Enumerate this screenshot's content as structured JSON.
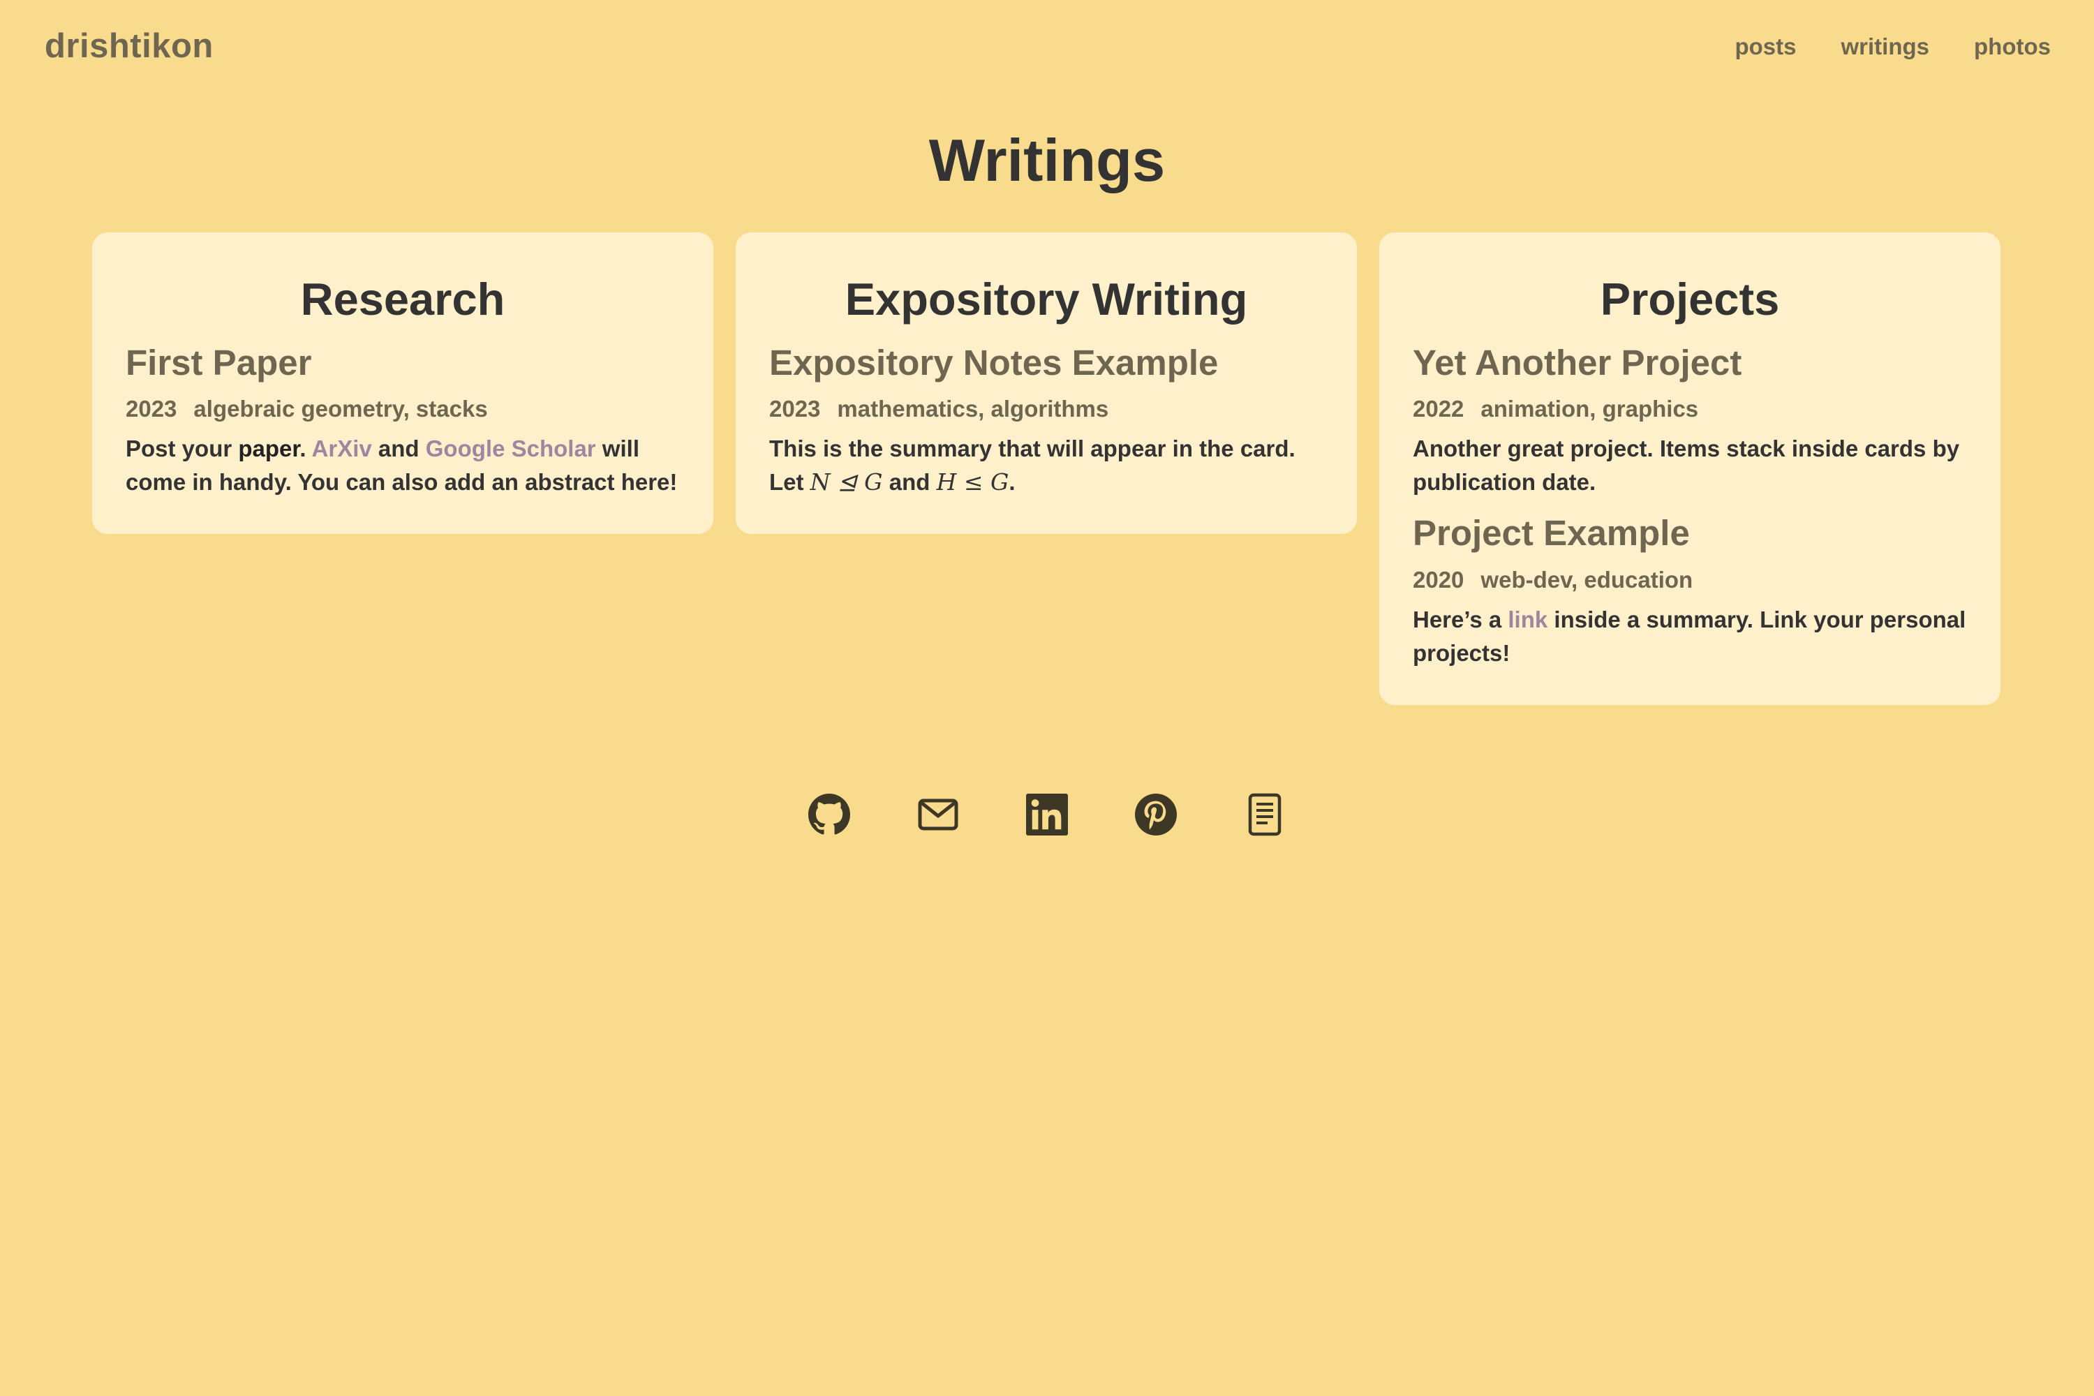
{
  "header": {
    "site_title": "drishtikon",
    "nav": [
      {
        "label": "posts"
      },
      {
        "label": "writings"
      },
      {
        "label": "photos"
      }
    ]
  },
  "page": {
    "title": "Writings"
  },
  "cards": [
    {
      "title": "Research",
      "entries": [
        {
          "title": "First Paper",
          "year": "2023",
          "tags": "algebraic geometry, stacks",
          "summary": {
            "t1": "Post your ",
            "bold": "paper",
            "t2": ". ",
            "link1": "ArXiv",
            "t3": " and ",
            "link2": "Google Scholar",
            "t4": " will come in handy. You can also add an abstract here!"
          }
        }
      ]
    },
    {
      "title": "Expository Writing",
      "entries": [
        {
          "title": "Expository Notes Example",
          "year": "2023",
          "tags": "mathematics, algorithms",
          "summary": {
            "t1": "This is the summary that will appear in the card. Let ",
            "math1": "N ⊴ G",
            "t2": " and ",
            "math2": "H ≤ G",
            "t3": "."
          }
        }
      ]
    },
    {
      "title": "Projects",
      "entries": [
        {
          "title": "Yet Another Project",
          "year": "2022",
          "tags": "animation, graphics",
          "summary": {
            "text": "Another great project. Items stack inside cards by publication date."
          }
        },
        {
          "title": "Project Example",
          "year": "2020",
          "tags": "web-dev, education",
          "summary": {
            "t1": "Here’s a ",
            "link": "link",
            "t2": " inside a summary. Link your personal projects!"
          }
        }
      ]
    }
  ],
  "socials": [
    {
      "icon": "github-icon"
    },
    {
      "icon": "mail-icon"
    },
    {
      "icon": "linkedin-icon"
    },
    {
      "icon": "pinterest-icon"
    },
    {
      "icon": "document-icon"
    }
  ],
  "colors": {
    "background": "#f9db8e",
    "card": "#fdf0cb",
    "link": "#a085a1",
    "heading": "#333333",
    "muted": "#6e6650"
  }
}
